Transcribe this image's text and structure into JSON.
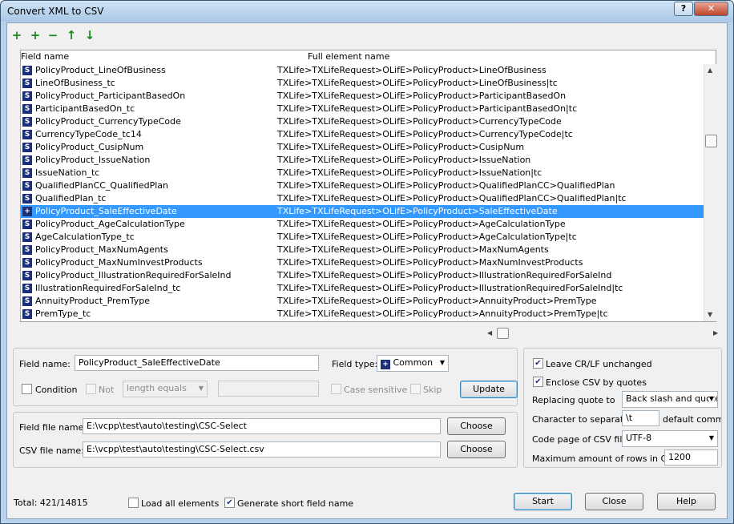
{
  "window": {
    "title": "Convert XML to CSV",
    "help_label": "?",
    "close_label": "✕"
  },
  "toolbar": {
    "add": "+",
    "add_alt": "+",
    "remove": "−",
    "up": "↑",
    "down": "↓"
  },
  "grid": {
    "col1": "Field name",
    "col2": "Full element name",
    "rows": [
      {
        "icon": "S",
        "name": "PolicyProduct_LineOfBusiness",
        "full": "TXLife>TXLifeRequest>OLifE>PolicyProduct>LineOfBusiness"
      },
      {
        "icon": "S",
        "name": "LineOfBusiness_tc",
        "full": "TXLife>TXLifeRequest>OLifE>PolicyProduct>LineOfBusiness|tc"
      },
      {
        "icon": "S",
        "name": "PolicyProduct_ParticipantBasedOn",
        "full": "TXLife>TXLifeRequest>OLifE>PolicyProduct>ParticipantBasedOn"
      },
      {
        "icon": "S",
        "name": "ParticipantBasedOn_tc",
        "full": "TXLife>TXLifeRequest>OLifE>PolicyProduct>ParticipantBasedOn|tc"
      },
      {
        "icon": "S",
        "name": "PolicyProduct_CurrencyTypeCode",
        "full": "TXLife>TXLifeRequest>OLifE>PolicyProduct>CurrencyTypeCode"
      },
      {
        "icon": "S",
        "name": "CurrencyTypeCode_tc14",
        "full": "TXLife>TXLifeRequest>OLifE>PolicyProduct>CurrencyTypeCode|tc"
      },
      {
        "icon": "S",
        "name": "PolicyProduct_CusipNum",
        "full": "TXLife>TXLifeRequest>OLifE>PolicyProduct>CusipNum"
      },
      {
        "icon": "S",
        "name": "PolicyProduct_IssueNation",
        "full": "TXLife>TXLifeRequest>OLifE>PolicyProduct>IssueNation"
      },
      {
        "icon": "S",
        "name": "IssueNation_tc",
        "full": "TXLife>TXLifeRequest>OLifE>PolicyProduct>IssueNation|tc"
      },
      {
        "icon": "S",
        "name": "QualifiedPlanCC_QualifiedPlan",
        "full": "TXLife>TXLifeRequest>OLifE>PolicyProduct>QualifiedPlanCC>QualifiedPlan"
      },
      {
        "icon": "S",
        "name": "QualifiedPlan_tc",
        "full": "TXLife>TXLifeRequest>OLifE>PolicyProduct>QualifiedPlanCC>QualifiedPlan|tc"
      },
      {
        "icon": "+",
        "name": "PolicyProduct_SaleEffectiveDate",
        "full": "TXLife>TXLifeRequest>OLifE>PolicyProduct>SaleEffectiveDate",
        "selected": true
      },
      {
        "icon": "S",
        "name": "PolicyProduct_AgeCalculationType",
        "full": "TXLife>TXLifeRequest>OLifE>PolicyProduct>AgeCalculationType"
      },
      {
        "icon": "S",
        "name": "AgeCalculationType_tc",
        "full": "TXLife>TXLifeRequest>OLifE>PolicyProduct>AgeCalculationType|tc"
      },
      {
        "icon": "S",
        "name": "PolicyProduct_MaxNumAgents",
        "full": "TXLife>TXLifeRequest>OLifE>PolicyProduct>MaxNumAgents"
      },
      {
        "icon": "S",
        "name": "PolicyProduct_MaxNumInvestProducts",
        "full": "TXLife>TXLifeRequest>OLifE>PolicyProduct>MaxNumInvestProducts"
      },
      {
        "icon": "S",
        "name": "PolicyProduct_IllustrationRequiredForSaleInd",
        "full": "TXLife>TXLifeRequest>OLifE>PolicyProduct>IllustrationRequiredForSaleInd"
      },
      {
        "icon": "S",
        "name": "IllustrationRequiredForSaleInd_tc",
        "full": "TXLife>TXLifeRequest>OLifE>PolicyProduct>IllustrationRequiredForSaleInd|tc"
      },
      {
        "icon": "S",
        "name": "AnnuityProduct_PremType",
        "full": "TXLife>TXLifeRequest>OLifE>PolicyProduct>AnnuityProduct>PremType"
      },
      {
        "icon": "S",
        "name": "PremType_tc",
        "full": "TXLife>TXLifeRequest>OLifE>PolicyProduct>AnnuityProduct>PremType|tc"
      }
    ]
  },
  "field": {
    "name_label": "Field name:",
    "name_value": "PolicyProduct_SaleEffectiveDate",
    "type_label": "Field type:",
    "type_icon": "+",
    "type_value": "Common",
    "condition_label": "Condition",
    "not_label": "Not",
    "op_value": "length equals",
    "case_label": "Case sensitive",
    "skip_label": "Skip",
    "update_label": "Update"
  },
  "files": {
    "field_file_label": "Field file name:",
    "field_file_value": "E:\\vcpp\\test\\auto\\testing\\CSC-Select",
    "csv_file_label": "CSV file name:",
    "csv_file_value": "E:\\vcpp\\test\\auto\\testing\\CSC-Select.csv",
    "choose_label": "Choose"
  },
  "options": {
    "leave_crlf": "Leave CR/LF unchanged",
    "enclose_quotes": "Enclose CSV by quotes",
    "replacing_label": "Replacing quote to",
    "replacing_value": "Back slash and quote",
    "separator_label": "Character to separate:",
    "separator_value": "\\t",
    "separator_hint": "default comma",
    "codepage_label": "Code page of CSV file:",
    "codepage_value": "UTF-8",
    "maxrows_label": "Maximum amount of rows in CSV:",
    "maxrows_value": "1200"
  },
  "footer": {
    "total": "Total: 421/14815",
    "load_all": "Load all elements",
    "gen_short": "Generate short field name",
    "start": "Start",
    "close": "Close",
    "help": "Help"
  },
  "checks": {
    "leave_crlf": "✔",
    "enclose_quotes": "✔",
    "gen_short": "✔"
  }
}
